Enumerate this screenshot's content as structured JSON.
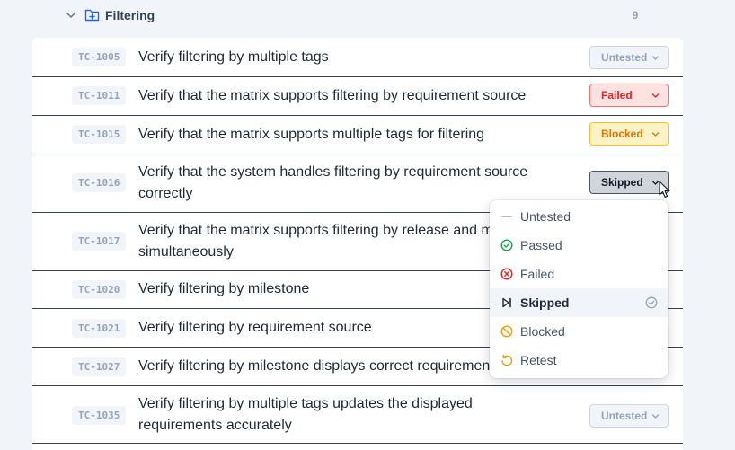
{
  "group": {
    "title": "Filtering",
    "count": "9"
  },
  "rows": [
    {
      "id": "TC-1005",
      "title_lines": [
        "Verify filtering by multiple tags"
      ],
      "status": "Untested"
    },
    {
      "id": "TC-1011",
      "title_lines": [
        "Verify that the matrix supports filtering by requirement source"
      ],
      "status": "Failed"
    },
    {
      "id": "TC-1015",
      "title_lines": [
        "Verify that the matrix supports multiple tags for filtering"
      ],
      "status": "Blocked"
    },
    {
      "id": "TC-1016",
      "title_lines": [
        "Verify that the system handles filtering by requirement source",
        "correctly"
      ],
      "status": "Skipped"
    },
    {
      "id": "TC-1017",
      "title_lines": [
        "Verify that the matrix supports filtering by release and m",
        "simultaneously"
      ],
      "status": ""
    },
    {
      "id": "TC-1020",
      "title_lines": [
        "Verify filtering by milestone"
      ],
      "status": ""
    },
    {
      "id": "TC-1021",
      "title_lines": [
        "Verify filtering by requirement source"
      ],
      "status": ""
    },
    {
      "id": "TC-1027",
      "title_lines": [
        "Verify filtering by milestone displays correct requiremen"
      ],
      "status": ""
    },
    {
      "id": "TC-1035",
      "title_lines": [
        "Verify filtering by multiple tags updates the displayed",
        "requirements accurately"
      ],
      "status": "Untested"
    }
  ],
  "status_menu": {
    "items": [
      {
        "label": "Untested",
        "icon": "dash-icon"
      },
      {
        "label": "Passed",
        "icon": "check-circle-icon"
      },
      {
        "label": "Failed",
        "icon": "x-circle-icon"
      },
      {
        "label": "Skipped",
        "icon": "skip-icon"
      },
      {
        "label": "Blocked",
        "icon": "ban-icon"
      },
      {
        "label": "Retest",
        "icon": "retest-icon"
      }
    ],
    "selected": "Skipped"
  },
  "colors": {
    "untested": "#94a3b8",
    "passed": "#16a34a",
    "failed": "#dc2626",
    "blocked": "#d97706",
    "retest": "#f59e0b",
    "folder": "#2563eb"
  }
}
